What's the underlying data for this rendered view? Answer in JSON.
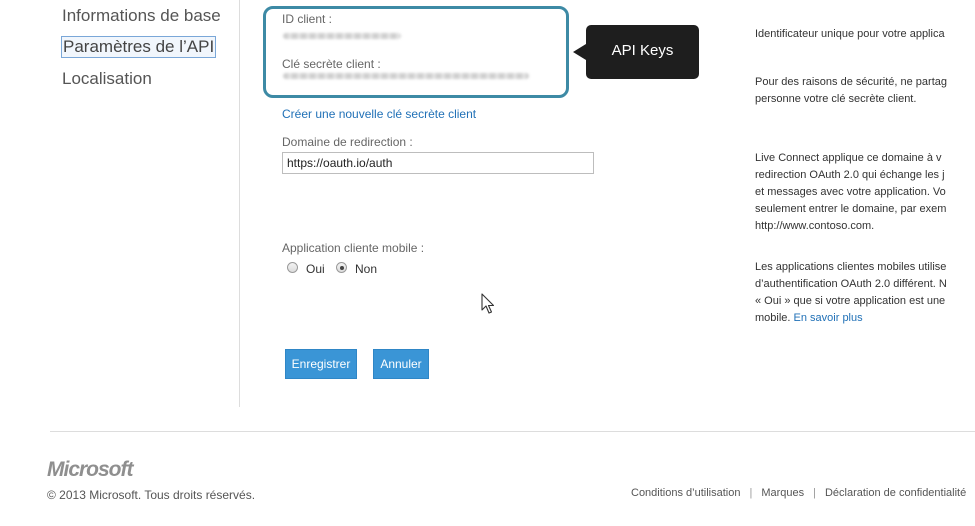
{
  "nav": {
    "items": [
      {
        "label": "Informations de base"
      },
      {
        "label": "Paramètres de l’API"
      },
      {
        "label": "Localisation"
      }
    ]
  },
  "keys": {
    "client_id_label": "ID client :",
    "client_secret_label": "Clé secrète client :"
  },
  "callout": {
    "text": "API Keys"
  },
  "new_secret_link": "Créer une nouvelle clé secrète client",
  "redirect": {
    "label": "Domaine de redirection :",
    "value": "https://oauth.io/auth"
  },
  "mobile": {
    "label": "Application cliente mobile :",
    "options": [
      "Oui",
      "Non"
    ],
    "selected": "Non"
  },
  "buttons": {
    "save": "Enregistrer",
    "cancel": "Annuler"
  },
  "help": {
    "client_id": "Identificateur unique pour votre applica",
    "secret_line1": "Pour des raisons de sécurité, ne partag",
    "secret_line2": "personne votre clé secrète client.",
    "redirect_lines": [
      "Live Connect applique ce domaine à v",
      "redirection OAuth 2.0 qui échange les j",
      "et messages avec votre application. Vo",
      "seulement entrer le domaine, par exem",
      "http://www.contoso.com."
    ],
    "mobile_lines": [
      "Les applications clientes mobiles utilise",
      "d’authentification OAuth 2.0 différent. N",
      "« Oui » que si votre application est une"
    ],
    "mobile_last_prefix": "mobile. ",
    "learn_more": "En savoir plus"
  },
  "footer": {
    "logo": "Microsoft",
    "copyright": "© 2013 Microsoft. Tous droits réservés.",
    "links": [
      "Conditions d’utilisation",
      "Marques",
      "Déclaration de confidentialité"
    ]
  },
  "colors": {
    "highlight_box": "#3d8aa5",
    "callout_bg": "#1e1e1e",
    "link": "#2171b7",
    "button": "#3a95d6"
  }
}
